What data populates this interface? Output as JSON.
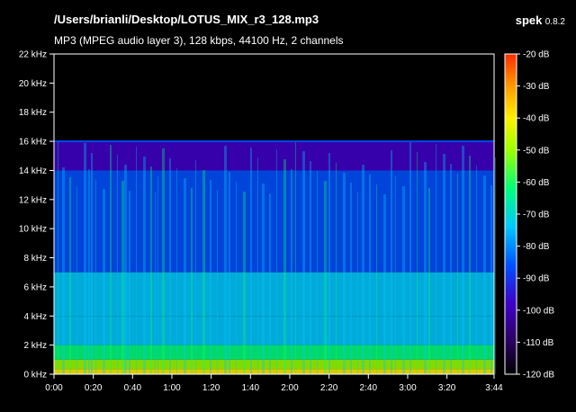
{
  "header": {
    "file_path": "/Users/brianli/Desktop/LOTUS_MIX_r3_128.mp3",
    "file_info": "MP3 (MPEG audio layer 3), 128 kbps, 44100 Hz, 2 channels",
    "app_name": "spek",
    "app_version": "0.8.2"
  },
  "frequency_axis": {
    "unit": "kHz",
    "ticks": [
      {
        "value": 0,
        "label": "0 kHz"
      },
      {
        "value": 2,
        "label": "2 kHz"
      },
      {
        "value": 4,
        "label": "4 kHz"
      },
      {
        "value": 6,
        "label": "6 kHz"
      },
      {
        "value": 8,
        "label": "8 kHz"
      },
      {
        "value": 10,
        "label": "10 kHz"
      },
      {
        "value": 12,
        "label": "12 kHz"
      },
      {
        "value": 14,
        "label": "14 kHz"
      },
      {
        "value": 16,
        "label": "16 kHz"
      },
      {
        "value": 18,
        "label": "18 kHz"
      },
      {
        "value": 20,
        "label": "20 kHz"
      },
      {
        "value": 22,
        "label": "22 kHz"
      }
    ],
    "range": [
      0,
      22
    ],
    "cutoff_khz": 16
  },
  "time_axis": {
    "ticks": [
      {
        "seconds": 0,
        "label": "0:00"
      },
      {
        "seconds": 20,
        "label": "0:20"
      },
      {
        "seconds": 40,
        "label": "0:40"
      },
      {
        "seconds": 60,
        "label": "1:00"
      },
      {
        "seconds": 80,
        "label": "1:20"
      },
      {
        "seconds": 100,
        "label": "1:40"
      },
      {
        "seconds": 120,
        "label": "2:00"
      },
      {
        "seconds": 140,
        "label": "2:20"
      },
      {
        "seconds": 160,
        "label": "2:40"
      },
      {
        "seconds": 180,
        "label": "3:00"
      },
      {
        "seconds": 200,
        "label": "3:20"
      },
      {
        "seconds": 224,
        "label": "3:44"
      }
    ],
    "range_seconds": [
      0,
      224
    ]
  },
  "db_scale": {
    "ticks": [
      {
        "value": -20,
        "label": "-20 dB"
      },
      {
        "value": -30,
        "label": "-30 dB"
      },
      {
        "value": -40,
        "label": "-40 dB"
      },
      {
        "value": -50,
        "label": "-50 dB"
      },
      {
        "value": -60,
        "label": "-60 dB"
      },
      {
        "value": -70,
        "label": "-70 dB"
      },
      {
        "value": -80,
        "label": "-80 dB"
      },
      {
        "value": -90,
        "label": "-90 dB"
      },
      {
        "value": -100,
        "label": "-100 dB"
      },
      {
        "value": -110,
        "label": "-110 dB"
      },
      {
        "value": -120,
        "label": "-120 dB"
      }
    ],
    "range": [
      -120,
      -20
    ],
    "palette": [
      "#000000",
      "#2a005c",
      "#3f00c8",
      "#0050ff",
      "#00c8ff",
      "#00ff7a",
      "#9cff00",
      "#fff000",
      "#ff9a00",
      "#ff2a00"
    ]
  },
  "colors": {
    "background": "#000000",
    "frame": "#ffffff",
    "text": "#ffffff"
  }
}
